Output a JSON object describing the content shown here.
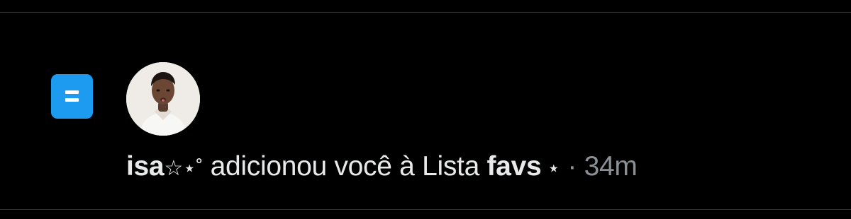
{
  "notification": {
    "icon": "list-icon",
    "avatar": "user-avatar",
    "user_name": "isa",
    "user_decoration": "☆⋆˚",
    "action_text": " adicionou você à Lista ",
    "list_name": "favs",
    "list_decoration": " ⋆",
    "separator": " · ",
    "timestamp": "34m"
  },
  "colors": {
    "background": "#000000",
    "divider": "#2f3336",
    "accent": "#1d9bf0",
    "text": "#e7e9ea",
    "muted": "#8b9096"
  }
}
